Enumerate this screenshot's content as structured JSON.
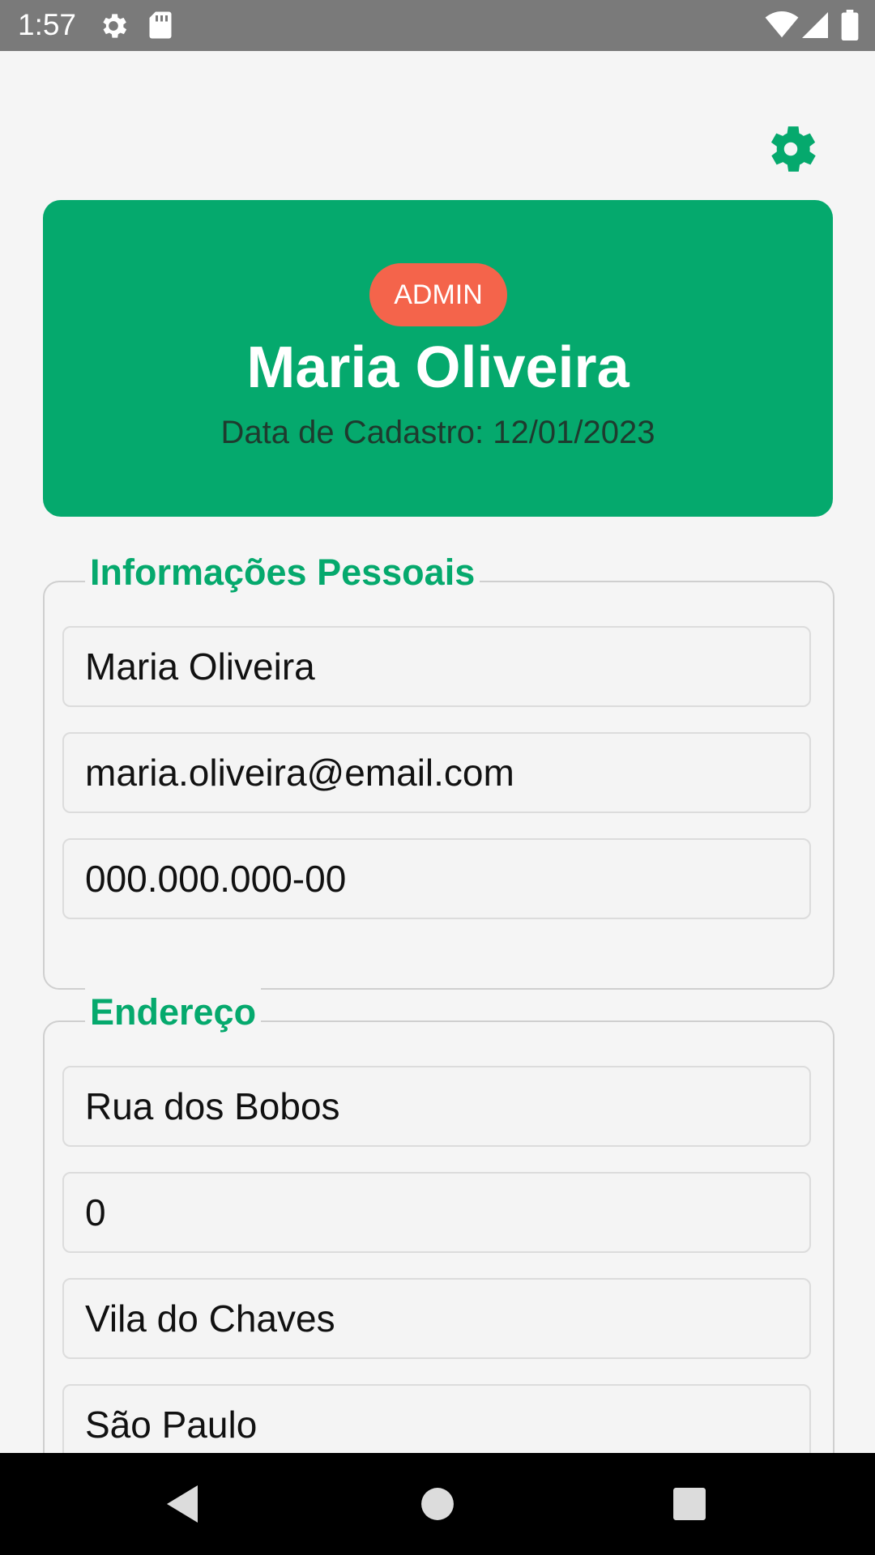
{
  "status_bar": {
    "time": "1:57",
    "icons": [
      "gear-icon",
      "sd-card-icon",
      "wifi-icon",
      "signal-icon",
      "battery-icon"
    ]
  },
  "header": {
    "settings_icon": "gear-icon"
  },
  "profile": {
    "role": "ADMIN",
    "name": "Maria Oliveira",
    "registration": "Data de Cadastro: 12/01/2023"
  },
  "personal_info": {
    "title": "Informações Pessoais",
    "fields": [
      "Maria Oliveira",
      "maria.oliveira@email.com",
      "000.000.000-00"
    ]
  },
  "address": {
    "title": "Endereço",
    "fields": [
      "Rua dos Bobos",
      "0",
      "Vila do Chaves",
      "São Paulo"
    ]
  },
  "nav": {
    "icons": [
      "back-icon",
      "home-icon",
      "recents-icon"
    ]
  },
  "colors": {
    "accent": "#05a96d",
    "badge": "#f4644b",
    "status_bar": "#7a7a7a",
    "background": "#f5f5f5"
  }
}
